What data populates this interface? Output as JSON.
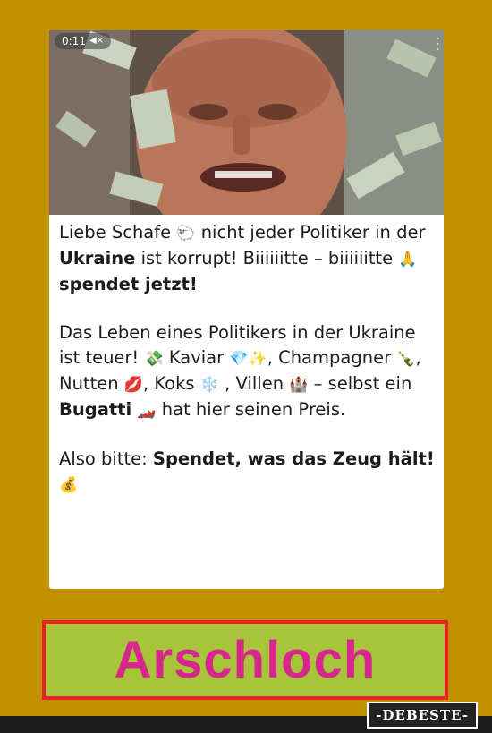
{
  "video": {
    "timestamp": "0:11",
    "mute_glyph": "◀×"
  },
  "post": {
    "p1": [
      "Liebe Schafe ",
      "🐑",
      " nicht jeder Politiker in der ",
      "Ukraine",
      " ist korrupt! Biiiiiitte – biiiiiitte ",
      "🙏",
      " ",
      "spendet jetzt!"
    ],
    "p2": [
      "Das Leben eines Politikers in der Ukraine ist teuer! ",
      "💸",
      " Kaviar ",
      "💎✨",
      ", Champagner ",
      "🍾",
      ", Nutten ",
      "💋",
      ", Koks ",
      "❄️",
      " , Villen ",
      "🏰",
      " – selbst ein ",
      "Bugatti",
      " ",
      "🏎️",
      " hat hier seinen Preis."
    ],
    "p3": [
      "Also bitte: ",
      "Spendet, was das Zeug hält!",
      " ",
      "💰"
    ]
  },
  "banner": {
    "label": "Arschloch"
  },
  "watermark": {
    "label": "-DEBESTE-"
  },
  "colors": {
    "background": "#c09200",
    "banner_bg": "#a8c43a",
    "banner_text": "#d6288c",
    "banner_border": "#e8202a"
  }
}
